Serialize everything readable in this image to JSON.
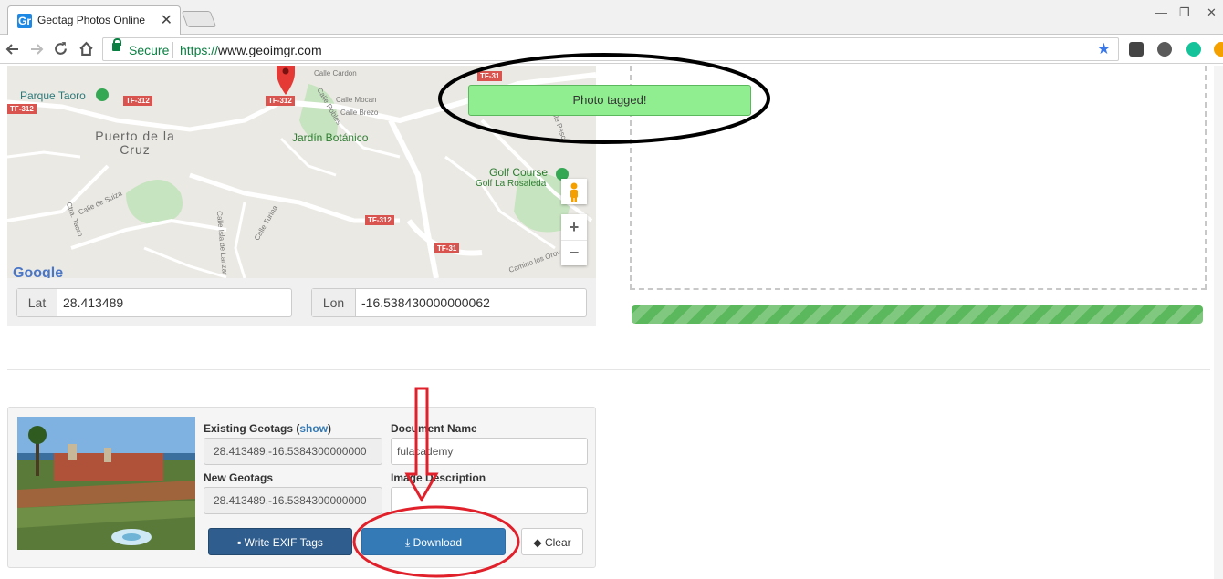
{
  "browser": {
    "tab_title": "Geotag Photos Online",
    "favicon_text": "Gr",
    "tab_close": "✕",
    "window_controls": [
      "—",
      "❐",
      "✕"
    ],
    "secure_label": "Secure",
    "url_scheme": "https://",
    "url_rest": "www.geoimgr.com",
    "icons": [
      "back-icon",
      "forward-icon",
      "reload-icon",
      "home-icon",
      "bookmark-star-icon"
    ]
  },
  "map": {
    "places": [
      "Parque Taoro",
      "Puerto de la Cruz",
      "Jardín Botánico",
      "Golf Course",
      "Golf La Rosaleda"
    ],
    "road_shields": [
      "TF-312",
      "TF-312",
      "TF-312",
      "TF-312",
      "TF-31",
      "TF-31"
    ],
    "streets": [
      "Calle Cardon",
      "Calle Mocan",
      "Calle Brezo",
      "Calle Robles",
      "Calle de Suiza",
      "Ctra. Taoro",
      "Calle Turina",
      "Calle Isla de Lanzar",
      "Camino los Orov",
      "Calle Pesco"
    ],
    "zoom_in": "+",
    "zoom_out": "−",
    "google_logo": "Google"
  },
  "coords": {
    "lat_label": "Lat",
    "lat_value": "28.413489",
    "lon_label": "Lon",
    "lon_value": "-16.538430000000062"
  },
  "status": {
    "toast": "Photo tagged!",
    "progress": 1.0
  },
  "photo_panel": {
    "existing_label": "Existing Geotags (",
    "show_link": "show",
    "existing_label_end": ")",
    "existing_value": "28.413489,-16.5384300000000",
    "new_label": "New Geotags",
    "new_value": "28.413489,-16.5384300000000",
    "doc_name_label": "Document Name",
    "doc_name_value": "fulacademy",
    "image_desc_label": "Image Description",
    "image_desc_value": "",
    "write_button": "Write EXIF Tags",
    "download_button": "Download",
    "clear_button": "Clear"
  },
  "colors": {
    "accent_blue": "#337ab7",
    "write_button": "#2f5d8d",
    "success_green": "#5cb85c",
    "toast_green": "#90ee90",
    "annotation_red": "#e0202a",
    "annotation_black": "#000000"
  }
}
